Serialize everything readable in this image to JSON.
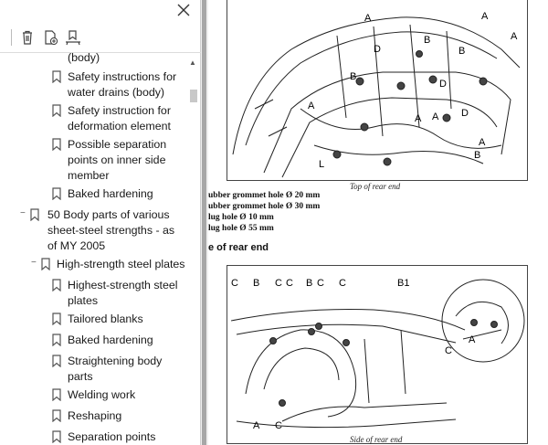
{
  "window": {
    "close_icon": "close-icon"
  },
  "toolbar": {
    "icons": [
      "delete-bookmark-icon",
      "add-bookmark-icon",
      "bookmark-settings-icon"
    ]
  },
  "tree": {
    "items": [
      {
        "label": "(body)"
      },
      {
        "label": "Safety instructions for water drains (body)"
      },
      {
        "label": "Safety instruction for deformation element"
      },
      {
        "label": "Possible separation points on inner side member"
      },
      {
        "label": "Baked hardening"
      },
      {
        "label": "50 Body parts of various sheet-steel strengths - as of MY 2005"
      },
      {
        "label": "High-strength steel plates"
      },
      {
        "label": "Highest-strength steel plates"
      },
      {
        "label": "Tailored blanks"
      },
      {
        "label": "Baked hardening"
      },
      {
        "label": "Straightening body parts"
      },
      {
        "label": "Welding work"
      },
      {
        "label": "Reshaping"
      },
      {
        "label": "Separation points"
      }
    ]
  },
  "document": {
    "figure1_caption": "Top of rear end",
    "legend": [
      "ubber grommet hole Ø 20 mm",
      "ubber grommet hole Ø 30 mm",
      "lug hole Ø 10 mm",
      "lug hole Ø 55 mm"
    ],
    "section_title": "e of rear end",
    "figure2_caption": "Side of rear end",
    "figure1_callouts": [
      "A",
      "A",
      "A",
      "D",
      "B",
      "B",
      "B",
      "D",
      "A",
      "A",
      "D",
      "A",
      "A",
      "B",
      "L"
    ],
    "figure2_callouts": [
      "C",
      "B",
      "C",
      "C",
      "B",
      "C",
      "C",
      "B1",
      "C",
      "A",
      "A",
      "C"
    ]
  }
}
